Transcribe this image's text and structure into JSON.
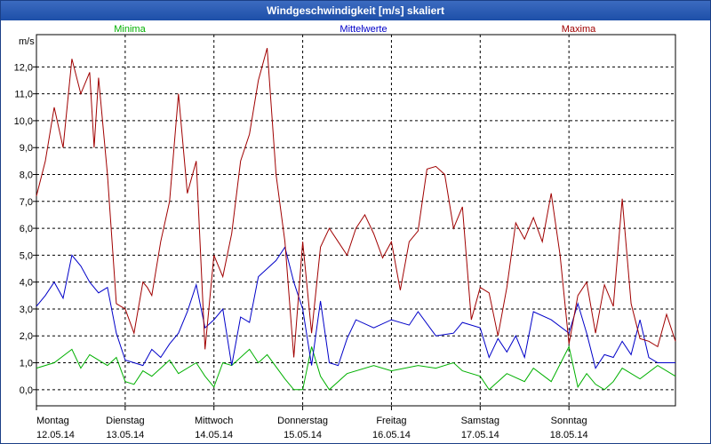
{
  "window": {
    "title": "Windgeschwindigkeit [m/s] skaliert"
  },
  "chart_data": {
    "type": "line",
    "ylabel": "m/s",
    "ylim": [
      -0.6,
      13.2
    ],
    "yticks": [
      "0,0",
      "1,0",
      "2,0",
      "3,0",
      "4,0",
      "5,0",
      "6,0",
      "7,0",
      "8,0",
      "9,0",
      "10,0",
      "11,0",
      "12,0"
    ],
    "xticks": [
      {
        "day": "Montag",
        "date": "12.05.14"
      },
      {
        "day": "Dienstag",
        "date": "13.05.14"
      },
      {
        "day": "Mittwoch",
        "date": "14.05.14"
      },
      {
        "day": "Donnerstag",
        "date": "15.05.14"
      },
      {
        "day": "Freitag",
        "date": "16.05.14"
      },
      {
        "day": "Samstag",
        "date": "17.05.14"
      },
      {
        "day": "Sonntag",
        "date": "18.05.14"
      }
    ],
    "xlim": [
      0,
      7.2
    ],
    "grid": true,
    "legend": "top",
    "series": [
      {
        "name": "Minima",
        "color": "#00b000",
        "x": [
          0,
          0.2,
          0.4,
          0.5,
          0.6,
          0.8,
          0.9,
          1.0,
          1.1,
          1.2,
          1.3,
          1.5,
          1.6,
          1.8,
          1.9,
          2.0,
          2.1,
          2.2,
          2.4,
          2.5,
          2.6,
          2.8,
          2.9,
          3.0,
          3.1,
          3.2,
          3.3,
          3.5,
          3.8,
          4.0,
          4.3,
          4.5,
          4.7,
          4.8,
          5.0,
          5.1,
          5.3,
          5.5,
          5.6,
          5.8,
          6.0,
          6.1,
          6.2,
          6.3,
          6.4,
          6.5,
          6.6,
          6.8,
          7.0,
          7.2
        ],
        "y": [
          0.8,
          1.0,
          1.5,
          0.8,
          1.3,
          0.9,
          1.2,
          0.3,
          0.2,
          0.7,
          0.5,
          1.1,
          0.6,
          1.0,
          0.5,
          0.1,
          1.0,
          0.9,
          1.5,
          1.0,
          1.3,
          0.4,
          0.0,
          0.0,
          1.6,
          0.5,
          0.0,
          0.6,
          0.9,
          0.7,
          0.9,
          0.8,
          1.0,
          0.7,
          0.5,
          0.0,
          0.6,
          0.3,
          0.8,
          0.3,
          1.6,
          0.1,
          0.6,
          0.2,
          0.0,
          0.3,
          0.8,
          0.4,
          0.9,
          0.5
        ]
      },
      {
        "name": "Mittelwerte",
        "color": "#0000c8",
        "x": [
          0,
          0.1,
          0.2,
          0.3,
          0.4,
          0.5,
          0.6,
          0.7,
          0.8,
          0.9,
          1.0,
          1.1,
          1.2,
          1.3,
          1.4,
          1.5,
          1.6,
          1.7,
          1.8,
          1.9,
          2.0,
          2.1,
          2.2,
          2.3,
          2.4,
          2.5,
          2.6,
          2.7,
          2.8,
          2.9,
          3.0,
          3.1,
          3.2,
          3.3,
          3.4,
          3.5,
          3.6,
          3.8,
          4.0,
          4.2,
          4.3,
          4.5,
          4.7,
          4.8,
          5.0,
          5.1,
          5.2,
          5.3,
          5.4,
          5.5,
          5.6,
          5.8,
          6.0,
          6.1,
          6.2,
          6.3,
          6.4,
          6.5,
          6.6,
          6.7,
          6.8,
          6.9,
          7.0,
          7.2
        ],
        "y": [
          3.1,
          3.5,
          4.0,
          3.4,
          5.0,
          4.6,
          4.0,
          3.6,
          3.8,
          2.1,
          1.1,
          1.0,
          0.9,
          1.5,
          1.2,
          1.7,
          2.1,
          2.9,
          3.9,
          2.3,
          2.6,
          3.0,
          0.9,
          2.7,
          2.5,
          4.2,
          4.5,
          4.8,
          5.3,
          4.0,
          3.0,
          0.9,
          3.3,
          1.0,
          0.9,
          1.9,
          2.6,
          2.3,
          2.6,
          2.4,
          2.9,
          2.0,
          2.1,
          2.5,
          2.3,
          1.2,
          1.9,
          1.4,
          2.0,
          1.2,
          2.9,
          2.6,
          2.1,
          3.2,
          2.1,
          0.8,
          1.3,
          1.2,
          1.8,
          1.3,
          2.6,
          1.2,
          1.0,
          1.0
        ]
      },
      {
        "name": "Maxima",
        "color": "#a00000",
        "x": [
          0,
          0.1,
          0.2,
          0.3,
          0.4,
          0.5,
          0.6,
          0.65,
          0.7,
          0.8,
          0.9,
          1.0,
          1.1,
          1.2,
          1.25,
          1.3,
          1.4,
          1.5,
          1.6,
          1.7,
          1.8,
          1.9,
          2.0,
          2.1,
          2.2,
          2.3,
          2.4,
          2.5,
          2.6,
          2.7,
          2.8,
          2.9,
          3.0,
          3.1,
          3.2,
          3.3,
          3.4,
          3.5,
          3.6,
          3.7,
          3.8,
          3.9,
          4.0,
          4.1,
          4.2,
          4.3,
          4.4,
          4.5,
          4.6,
          4.7,
          4.8,
          4.9,
          5.0,
          5.1,
          5.2,
          5.3,
          5.4,
          5.5,
          5.6,
          5.7,
          5.8,
          5.9,
          6.0,
          6.1,
          6.2,
          6.3,
          6.4,
          6.5,
          6.6,
          6.7,
          6.8,
          6.9,
          7.0,
          7.1,
          7.2
        ],
        "y": [
          7.2,
          8.5,
          10.5,
          9.0,
          12.3,
          11.0,
          11.8,
          9.0,
          11.6,
          8.0,
          3.2,
          3.0,
          2.1,
          4.0,
          3.8,
          3.5,
          5.5,
          7.0,
          11.0,
          7.3,
          8.5,
          1.5,
          5.0,
          4.2,
          5.8,
          8.5,
          9.5,
          11.5,
          12.7,
          8.0,
          5.5,
          1.2,
          5.5,
          2.1,
          5.3,
          6.0,
          5.5,
          5.0,
          6.0,
          6.5,
          5.8,
          4.9,
          5.5,
          3.7,
          5.5,
          5.9,
          8.2,
          8.3,
          8.0,
          6.0,
          6.8,
          2.6,
          3.8,
          3.6,
          2.0,
          3.8,
          6.2,
          5.6,
          6.4,
          5.5,
          7.3,
          5.0,
          1.7,
          3.5,
          4.0,
          2.1,
          3.9,
          3.1,
          7.1,
          3.2,
          1.9,
          1.8,
          1.6,
          2.8,
          1.8
        ]
      }
    ]
  }
}
